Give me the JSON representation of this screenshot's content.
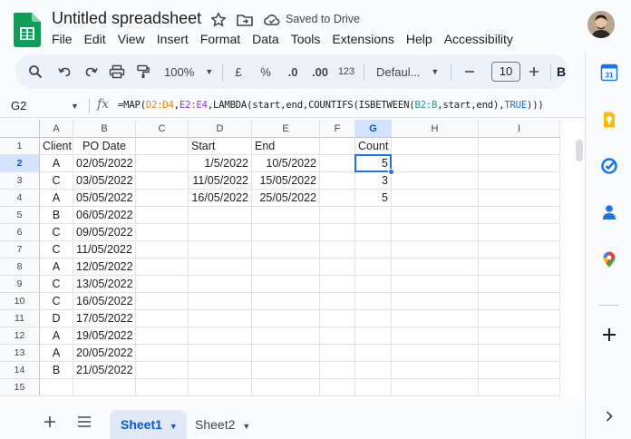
{
  "doc": {
    "title": "Untitled spreadsheet",
    "save_status": "Saved to Drive"
  },
  "menu": [
    "File",
    "Edit",
    "View",
    "Insert",
    "Format",
    "Data",
    "Tools",
    "Extensions",
    "Help",
    "Accessibility"
  ],
  "toolbar": {
    "zoom": "100%",
    "currency": "£",
    "percent": "%",
    "dec_decrease": ".0",
    "dec_increase": ".00",
    "number_format": "123",
    "font": "Defaul...",
    "font_size": "10",
    "bold": "B"
  },
  "formula_bar": {
    "cell_ref": "G2",
    "fx": "fx",
    "formula_parts": [
      {
        "text": "=MAP(",
        "color": ""
      },
      {
        "text": "D2:D4",
        "color": "#e2891b"
      },
      {
        "text": ",",
        "color": ""
      },
      {
        "text": "E2:E4",
        "color": "#9334e6"
      },
      {
        "text": ",LAMBDA(start,end,COUNTIFS(ISBETWEEN(",
        "color": ""
      },
      {
        "text": "B2:B",
        "color": "#1a9e8f"
      },
      {
        "text": ",start,end),",
        "color": ""
      },
      {
        "text": "TRUE",
        "color": "#1a73e8"
      },
      {
        "text": ")))",
        "color": ""
      }
    ]
  },
  "grid": {
    "columns": [
      "A",
      "B",
      "C",
      "D",
      "E",
      "F",
      "G",
      "H",
      "I"
    ],
    "rows": [
      "1",
      "2",
      "3",
      "4",
      "5",
      "6",
      "7",
      "8",
      "9",
      "10",
      "11",
      "12",
      "13",
      "14",
      "15"
    ],
    "selected_cell": "G2",
    "cells": {
      "A1": "Client",
      "B1": "PO Date",
      "D1": "Start",
      "E1": "End",
      "G1": "Count",
      "A2": "A",
      "B2": "02/05/2022",
      "D2": "1/5/2022",
      "E2": "10/5/2022",
      "G2": "5",
      "A3": "C",
      "B3": "03/05/2022",
      "D3": "11/05/2022",
      "E3": "15/05/2022",
      "G3": "3",
      "A4": "A",
      "B4": "05/05/2022",
      "D4": "16/05/2022",
      "E4": "25/05/2022",
      "G4": "5",
      "A5": "B",
      "B5": "06/05/2022",
      "A6": "C",
      "B6": "09/05/2022",
      "A7": "C",
      "B7": "11/05/2022",
      "A8": "A",
      "B8": "12/05/2022",
      "A9": "C",
      "B9": "13/05/2022",
      "A10": "C",
      "B10": "16/05/2022",
      "A11": "D",
      "B11": "17/05/2022",
      "A12": "A",
      "B12": "19/05/2022",
      "A13": "A",
      "B13": "20/05/2022",
      "A14": "B",
      "B14": "21/05/2022"
    }
  },
  "sheets": [
    {
      "name": "Sheet1",
      "active": true
    },
    {
      "name": "Sheet2",
      "active": false
    }
  ],
  "side_panel": [
    "calendar-icon",
    "keep-icon",
    "tasks-icon",
    "contacts-icon",
    "maps-icon",
    "add-icon",
    "expand-icon"
  ],
  "colors": {
    "accent": "#1a73e8",
    "toolbar_bg": "#edf2fa",
    "sheets_green": "#0f9d58"
  }
}
